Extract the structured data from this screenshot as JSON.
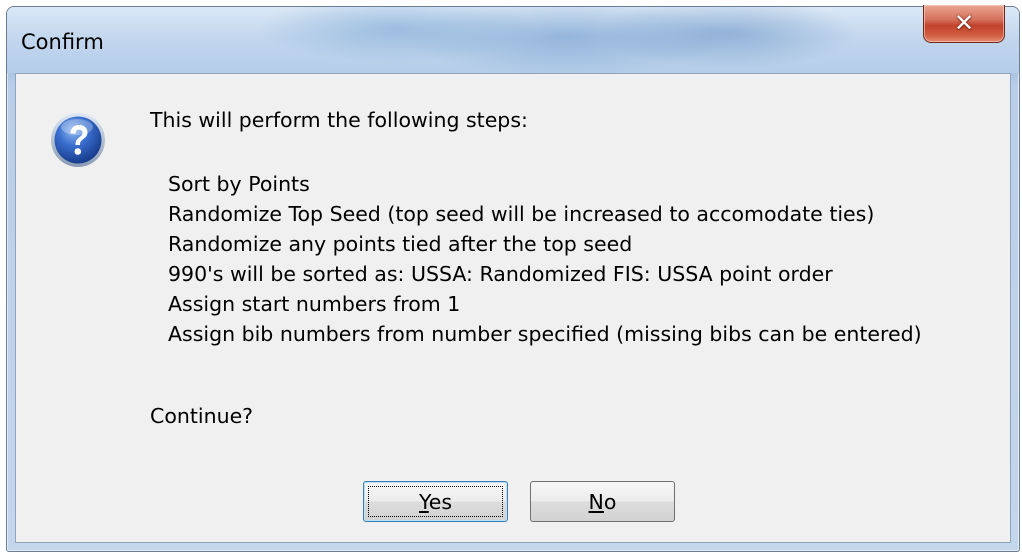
{
  "window": {
    "title": "Confirm",
    "close_icon": "close-icon"
  },
  "message": {
    "icon": "question-icon",
    "intro": "This will perform the following steps:",
    "steps": [
      "Sort by Points",
      "Randomize Top Seed  (top seed will be increased to accomodate ties)",
      "Randomize any points tied after the top seed",
      "990's will be sorted as:  USSA: Randomized    FIS: USSA point order",
      "Assign start numbers from 1",
      "Assign bib numbers from number specified (missing bibs can be entered)"
    ],
    "prompt": "Continue?"
  },
  "buttons": {
    "yes": {
      "mnemonic": "Y",
      "rest": "es"
    },
    "no": {
      "mnemonic": "N",
      "rest": "o"
    }
  },
  "colors": {
    "client_background": "#f0f0f0",
    "titlebar": "#b5cde9",
    "close_button": "#c2432b",
    "default_button_border": "#3c7fb1"
  }
}
